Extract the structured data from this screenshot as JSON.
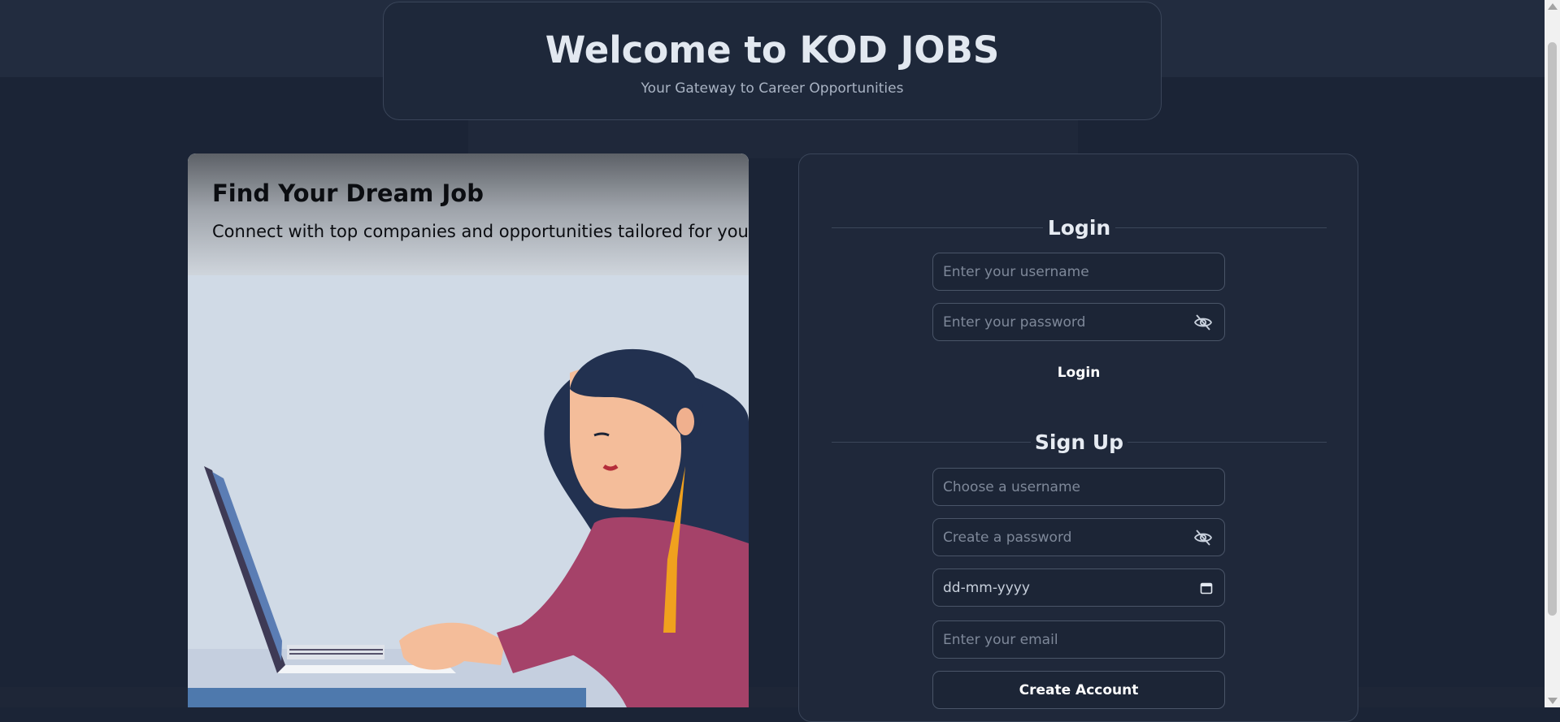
{
  "colors": {
    "background": "#1b2436",
    "panel": "#1f283a",
    "border": "#3a4559",
    "text": "#e2e8f0",
    "muted": "#a9b3c3"
  },
  "header": {
    "title": "Welcome to KOD JOBS",
    "subtitle": "Your Gateway to Career Opportunities"
  },
  "hero": {
    "heading": "Find Your Dream Job",
    "subheading": "Connect with top companies and opportunities tailored for you"
  },
  "login": {
    "title": "Login",
    "username_placeholder": "Enter your username",
    "password_placeholder": "Enter your password",
    "password_toggle_icon": "eye-slash-icon",
    "submit_label": "Login"
  },
  "signup": {
    "title": "Sign Up",
    "username_placeholder": "Choose a username",
    "password_placeholder": "Create a password",
    "password_toggle_icon": "eye-slash-icon",
    "dob_value": "dd-mm-yyyy",
    "calendar_icon": "calendar-icon",
    "email_placeholder": "Enter your email",
    "submit_label": "Create Account"
  }
}
